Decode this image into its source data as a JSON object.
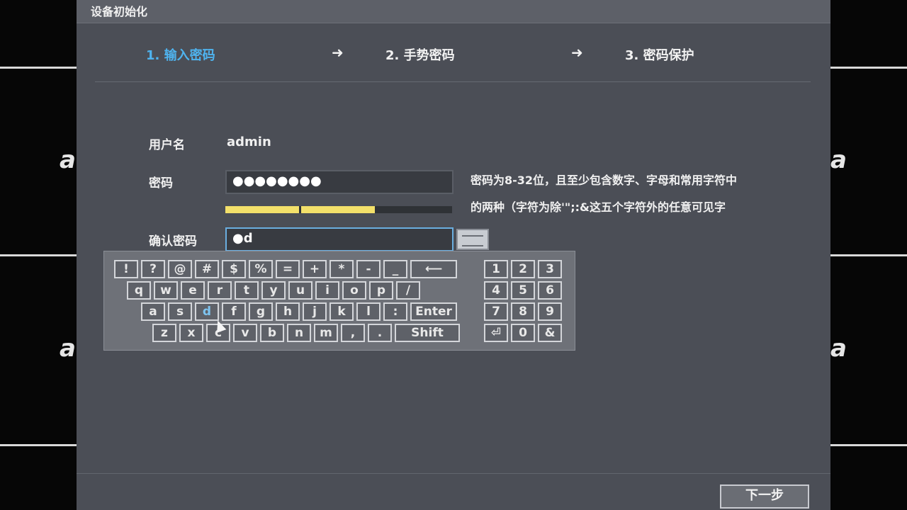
{
  "dialog": {
    "title": "设备初始化"
  },
  "steps": [
    {
      "label": "1. 输入密码",
      "active": true
    },
    {
      "label": "2. 手势密码",
      "active": false
    },
    {
      "label": "3. 密码保护",
      "active": false
    }
  ],
  "arrow_glyph": "➜",
  "form": {
    "username_label": "用户名",
    "username_value": "admin",
    "password_label": "密码",
    "password_value": "●●●●●●●●",
    "strength_percent": 66,
    "confirm_label": "确认密码",
    "confirm_value": "●d"
  },
  "hint": {
    "line1": "密码为8-32位，且至少包含数字、字母和常用字符中",
    "line2": "的两种（字符为除'\";:&这五个字符外的任意可见字"
  },
  "keyboard": {
    "row1": [
      "!",
      "?",
      "@",
      "#",
      "$",
      "%",
      "=",
      "+",
      "*",
      "-",
      "_",
      "⟵"
    ],
    "row2": [
      "q",
      "w",
      "e",
      "r",
      "t",
      "y",
      "u",
      "i",
      "o",
      "p",
      "/"
    ],
    "row3": [
      "a",
      "s",
      "d",
      "f",
      "g",
      "h",
      "j",
      "k",
      "l",
      ":",
      "Enter"
    ],
    "row4": [
      "z",
      "x",
      "c",
      "v",
      "b",
      "n",
      "m",
      ",",
      ".",
      "Shift"
    ],
    "numpad": [
      "1",
      "2",
      "3",
      "4",
      "5",
      "6",
      "7",
      "8",
      "9",
      "⏎",
      "0",
      "&"
    ],
    "highlighted_key": "d"
  },
  "footer": {
    "next_label": "下一步"
  },
  "colors": {
    "accent": "#4fb3ee",
    "strength": "#f3e06a",
    "dialog_bg": "#4b4e56"
  }
}
